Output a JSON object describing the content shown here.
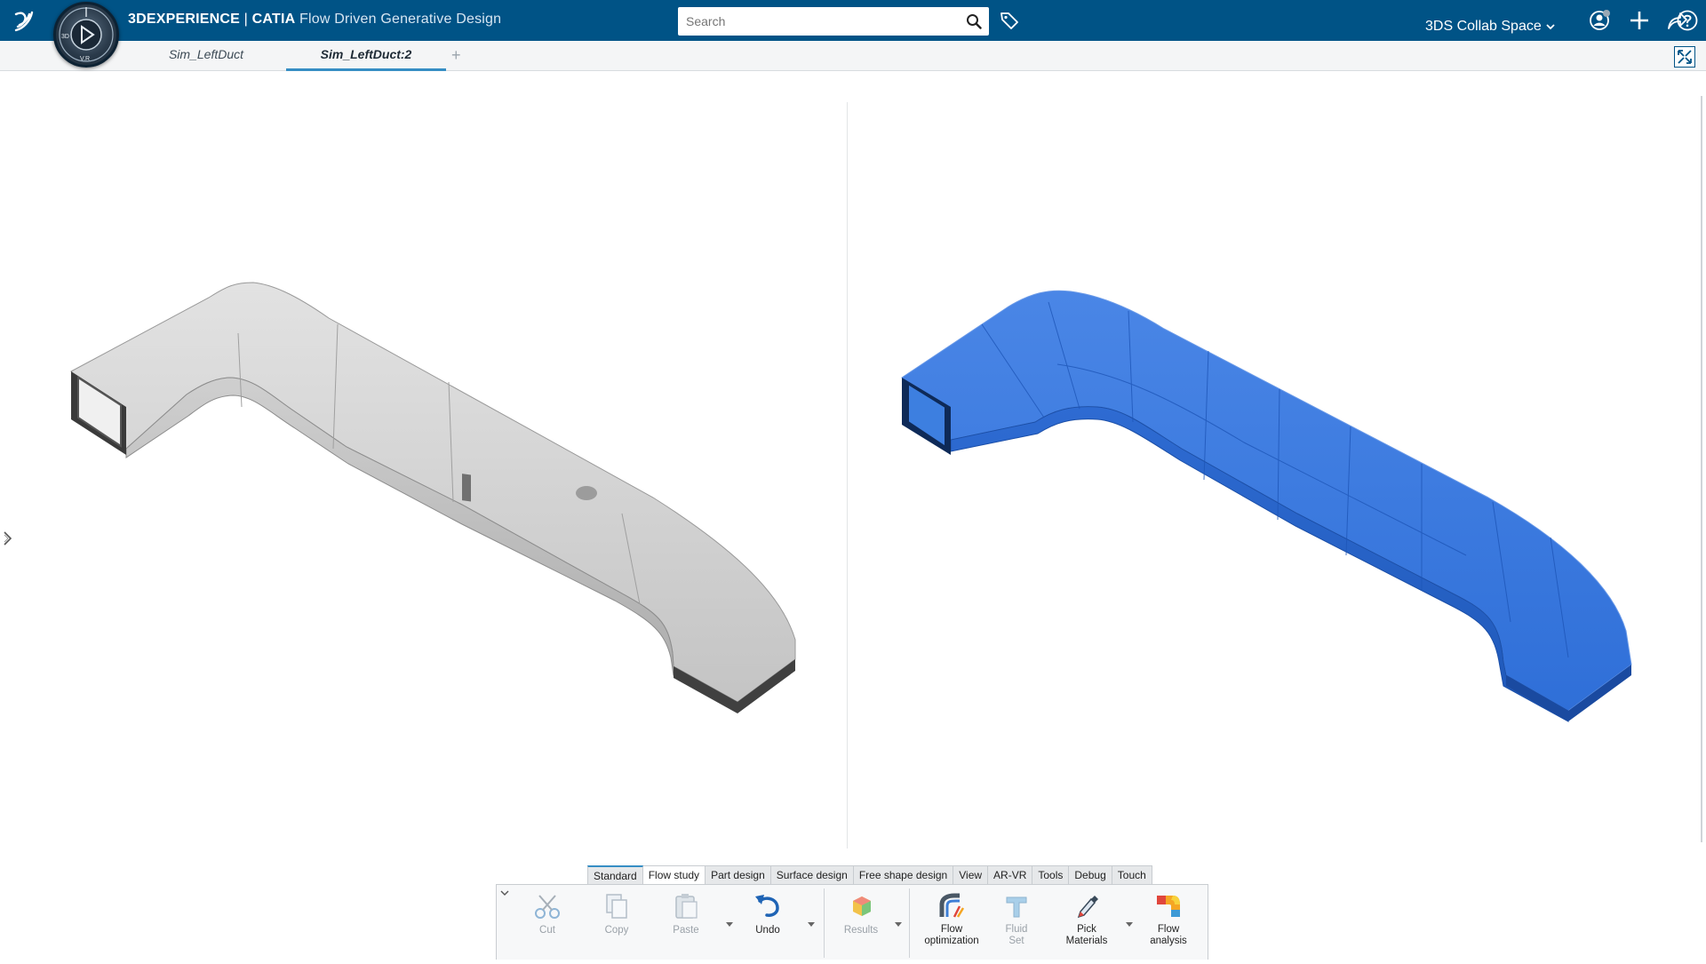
{
  "topbar": {
    "title_brand": "3DEXPERIENCE",
    "title_sep": " | ",
    "title_app": "CATIA",
    "title_role": "Flow Driven Generative Design",
    "search_placeholder": "Search",
    "collab_space": "3DS Collab Space",
    "compass_labels": [
      "3D",
      "V.R"
    ]
  },
  "tabs": {
    "items": [
      {
        "label": "Sim_LeftDuct"
      },
      {
        "label": "Sim_LeftDuct:2"
      }
    ],
    "active": 1,
    "add_label": "+"
  },
  "viewport": {
    "left_model": {
      "color": "#c8c8c8"
    },
    "right_model": {
      "color": "#2f6fd8"
    }
  },
  "ribbon": {
    "tabs": [
      "Standard",
      "Flow study",
      "Part design",
      "Surface design",
      "Free shape design",
      "View",
      "AR-VR",
      "Tools",
      "Debug",
      "Touch"
    ],
    "active_tab": 1,
    "commands": {
      "cut": "Cut",
      "copy": "Copy",
      "paste": "Paste",
      "undo": "Undo",
      "results": "Results",
      "flow_optimization_1": "Flow",
      "flow_optimization_2": "optimization",
      "fluid_set_1": "Fluid",
      "fluid_set_2": "Set",
      "pick_materials_1": "Pick",
      "pick_materials_2": "Materials",
      "flow_analysis_1": "Flow",
      "flow_analysis_2": "analysis"
    }
  },
  "colors": {
    "topbar": "#005386",
    "accent": "#368ec4",
    "duct_blue": "#2f6fd8",
    "duct_grey": "#c8c8c8"
  },
  "icons": [
    "ds-logo-icon",
    "compass-icon",
    "search-icon",
    "tag-icon",
    "user-icon",
    "plus-icon",
    "share-icon",
    "help-icon",
    "expand-icon",
    "chevron-right-icon",
    "cut-icon",
    "copy-icon",
    "paste-icon",
    "undo-icon",
    "results-icon",
    "flow-optimization-icon",
    "fluid-set-icon",
    "pick-materials-icon",
    "flow-analysis-icon"
  ]
}
